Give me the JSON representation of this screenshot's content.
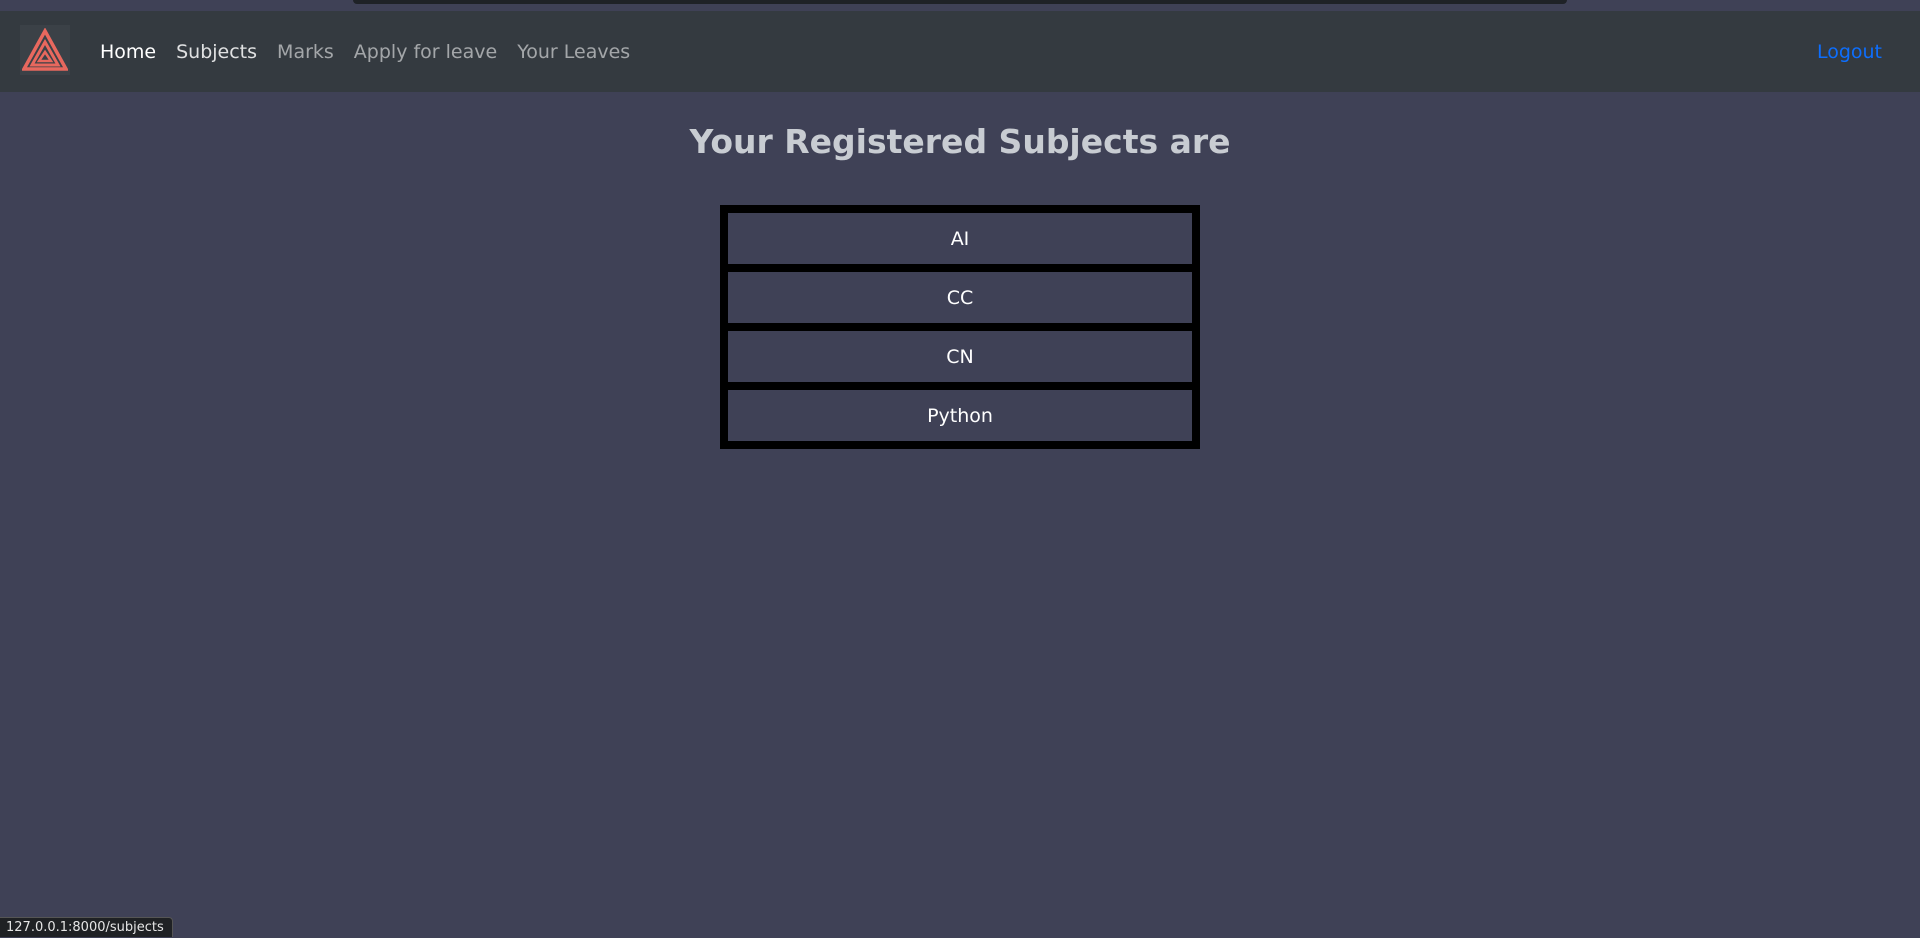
{
  "navbar": {
    "brand_icon": "triangle-logo-icon",
    "links": [
      {
        "label": "Home"
      },
      {
        "label": "Subjects"
      },
      {
        "label": "Marks"
      },
      {
        "label": "Apply for leave"
      },
      {
        "label": "Your Leaves"
      }
    ],
    "logout_label": "Logout"
  },
  "main": {
    "title": "Your Registered Subjects are",
    "subjects": [
      "AI",
      "CC",
      "CN",
      "Python"
    ]
  },
  "status_bar": {
    "url": "127.0.0.1:8000/subjects"
  },
  "colors": {
    "background": "#3f4156",
    "navbar": "#343a40",
    "logout_link": "#0d6efd",
    "brand_triangle": "#e8685e"
  }
}
